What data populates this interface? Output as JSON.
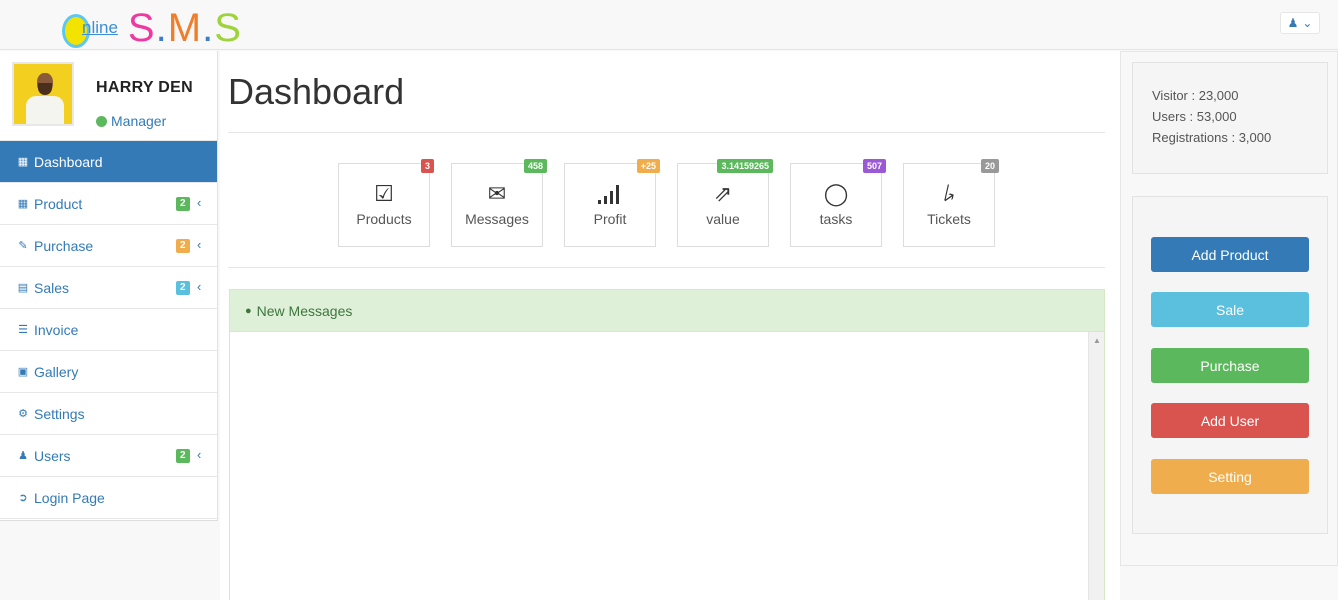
{
  "brand": {
    "online": "nline",
    "s1": "S",
    "dot1": ".",
    "m": "M",
    "dot2": ".",
    "s2": "S"
  },
  "header": {
    "user_icon": "user-icon",
    "caret_icon": "chevron-down-icon"
  },
  "profile": {
    "name": "HARRY DEN",
    "role": "Manager",
    "status_color": "#5cb85c"
  },
  "sidebar": {
    "items": [
      {
        "label": "Dashboard",
        "icon": "table-icon",
        "active": true
      },
      {
        "label": "Product",
        "icon": "table-icon",
        "badge": "2",
        "badge_color": "#5cb85c"
      },
      {
        "label": "Purchase",
        "icon": "pencil-icon",
        "badge": "2",
        "badge_color": "#f0ad4e"
      },
      {
        "label": "Sales",
        "icon": "cart-icon",
        "badge": "2",
        "badge_color": "#5bc0de"
      },
      {
        "label": "Invoice",
        "icon": "list-icon"
      },
      {
        "label": "Gallery",
        "icon": "picture-icon"
      },
      {
        "label": "Settings",
        "icon": "cogs-icon"
      },
      {
        "label": "Users",
        "icon": "user-icon",
        "badge": "2",
        "badge_color": "#5cb85c"
      },
      {
        "label": "Login Page",
        "icon": "sign-in-icon"
      }
    ]
  },
  "main": {
    "title": "Dashboard",
    "tiles": [
      {
        "label": "Products",
        "badge": "3",
        "badge_color": "#d9534f",
        "icon": "check-square-icon"
      },
      {
        "label": "Messages",
        "badge": "458",
        "badge_color": "#5cb85c",
        "icon": "envelope-icon"
      },
      {
        "label": "Profit",
        "badge": "+25",
        "badge_color": "#f0ad4e",
        "icon": "signal-icon"
      },
      {
        "label": "value",
        "badge": "3.14159265",
        "badge_color": "#5cb85c",
        "icon": "external-link-icon"
      },
      {
        "label": "tasks",
        "badge": "507",
        "badge_color": "#9b59d6",
        "icon": "comment-icon"
      },
      {
        "label": "Tickets",
        "badge": "20",
        "badge_color": "#999999",
        "icon": "bolt-icon"
      }
    ],
    "messages_panel": {
      "title": "New Messages",
      "icon": "comments-icon"
    }
  },
  "stats": {
    "visitor": "Visitor   : 23,000",
    "users": "Users   : 53,000",
    "registrations": "Registrations   : 3,000"
  },
  "actions": [
    {
      "label": "Add Product",
      "color": "#337ab7"
    },
    {
      "label": "Sale",
      "color": "#5bc0de"
    },
    {
      "label": "Purchase",
      "color": "#5cb85c"
    },
    {
      "label": "Add User",
      "color": "#d9534f"
    },
    {
      "label": "Setting",
      "color": "#f0ad4e"
    }
  ]
}
